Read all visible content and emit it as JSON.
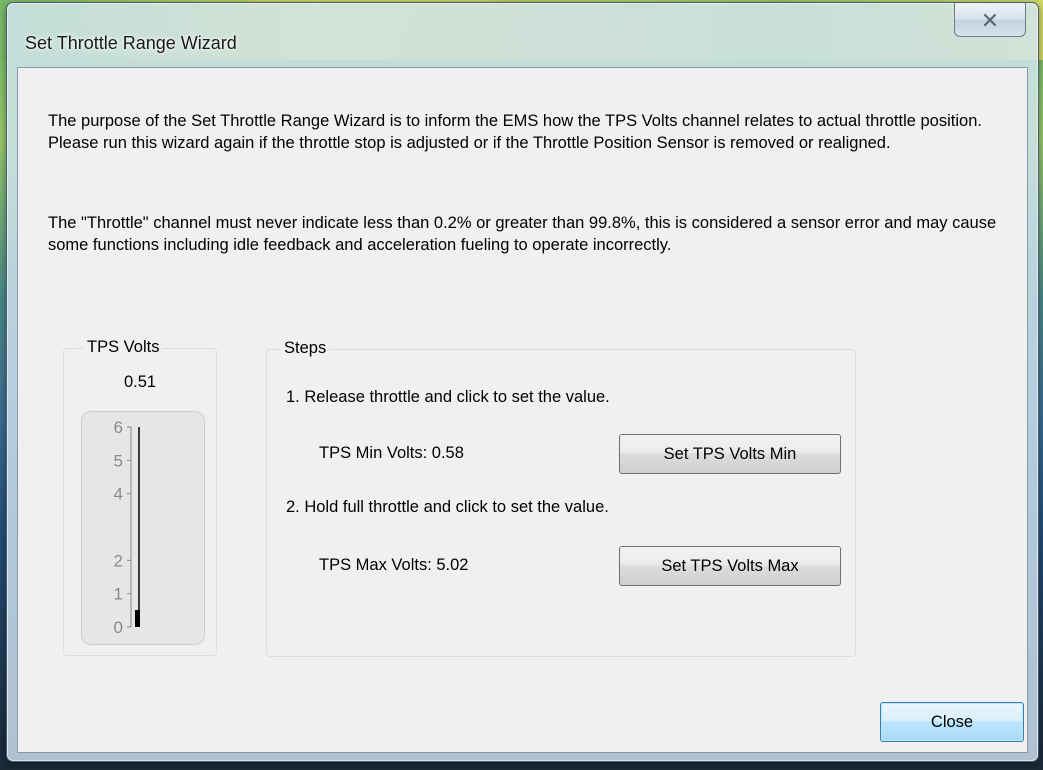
{
  "window": {
    "title": "Set Throttle Range Wizard"
  },
  "intro": {
    "paragraph1": "The purpose of the Set Throttle Range Wizard is to inform the EMS how the TPS Volts channel relates to actual throttle position. Please run this wizard again if the throttle stop is adjusted or if the Throttle Position Sensor is removed or realigned.",
    "paragraph2": "The \"Throttle\" channel must never indicate less than 0.2% or greater than 99.8%, this is considered a sensor error and may cause some functions including idle feedback and acceleration fueling to operate incorrectly."
  },
  "tps_gauge": {
    "label": "TPS Volts",
    "value": "0.51",
    "value_number": 0.51,
    "scale_min": 0,
    "scale_max": 6,
    "ticks": [
      "6",
      "5",
      "4",
      "2",
      "1",
      "0"
    ]
  },
  "steps": {
    "label": "Steps",
    "step1": "1. Release throttle and click to set the value.",
    "min_label": "TPS Min Volts: 0.58",
    "set_min_button": "Set TPS Volts Min",
    "step2": "2. Hold full throttle and click to set the value.",
    "max_label": "TPS Max Volts: 5.02",
    "set_max_button": "Set TPS Volts Max"
  },
  "footer": {
    "close_button": "Close"
  },
  "icons": {
    "window_close": "close-icon"
  }
}
